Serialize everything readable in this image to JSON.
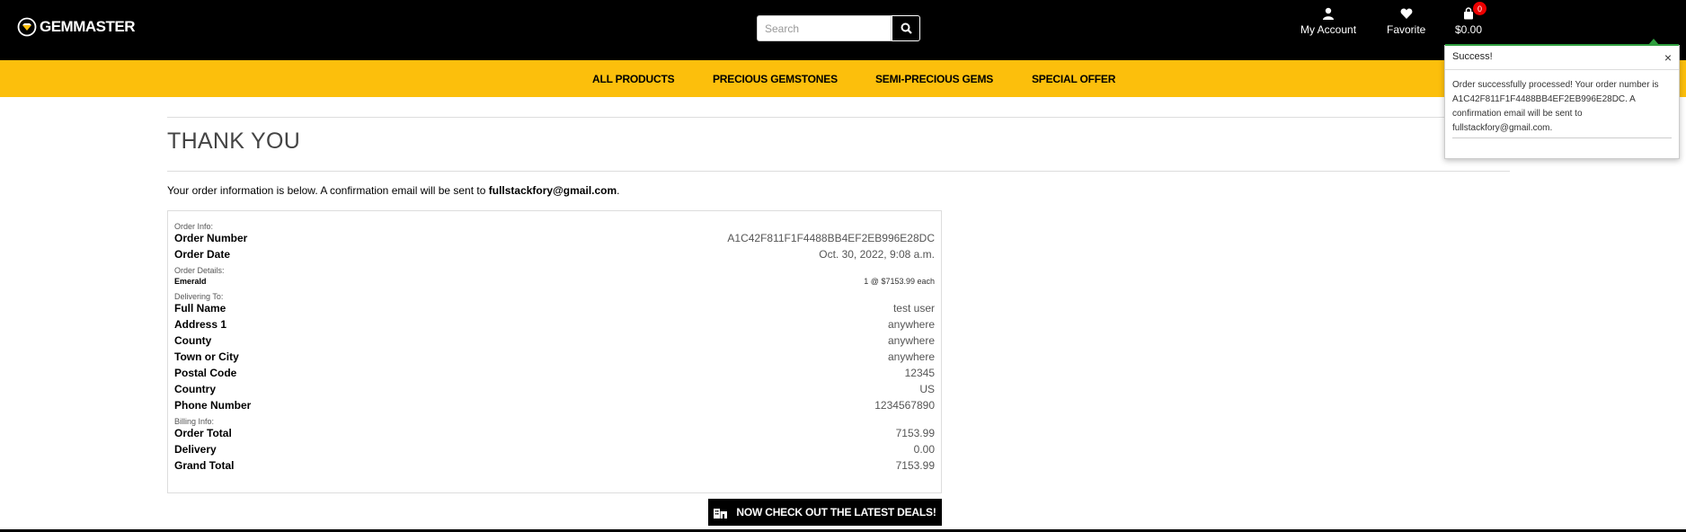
{
  "header": {
    "logo_text": "GEMMASTER",
    "search_placeholder": "Search",
    "account_label": "My Account",
    "favorite_label": "Favorite",
    "cart_total": "$0.00",
    "cart_count": "0"
  },
  "menu": [
    "ALL PRODUCTS",
    "PRECIOUS GEMSTONES",
    "SEMI-PRECIOUS GEMS",
    "SPECIAL OFFER"
  ],
  "page": {
    "title": "THANK YOU",
    "intro_prefix": "Your order information is below. A confirmation email will be sent to ",
    "email": "fullstackfory@gmail.com",
    "intro_suffix": "."
  },
  "order": {
    "order_info_label": "Order Info:",
    "order_number_label": "Order Number",
    "order_number": "A1C42F811F1F4488BB4EF2EB996E28DC",
    "order_date_label": "Order Date",
    "order_date": "Oct. 30, 2022, 9:08 a.m.",
    "order_details_label": "Order Details:",
    "item_name": "Emerald",
    "item_qty_price": "1 @ $7153.99 each",
    "delivering_label": "Delivering To:",
    "full_name_label": "Full Name",
    "full_name": "test user",
    "address1_label": "Address 1",
    "address1": "anywhere",
    "county_label": "County",
    "county": "anywhere",
    "town_label": "Town or City",
    "town": "anywhere",
    "postal_label": "Postal Code",
    "postal": "12345",
    "country_label": "Country",
    "country": "US",
    "phone_label": "Phone Number",
    "phone": "1234567890",
    "billing_label": "Billing Info:",
    "order_total_label": "Order Total",
    "order_total": "7153.99",
    "delivery_label": "Delivery",
    "delivery": "0.00",
    "grand_total_label": "Grand Total",
    "grand_total": "7153.99"
  },
  "deals_button": "NOW CHECK OUT THE LATEST DEALS!",
  "toast": {
    "title": "Success!",
    "close": "×",
    "message": "Order successfully processed! Your order number is A1C42F811F1F4488BB4EF2EB996E28DC. A confirmation email will be sent to fullstackfory@gmail.com."
  },
  "colors": {
    "header_bg": "#000000",
    "nav_bg": "#fcbf0c",
    "success": "#2e9e3e",
    "badge": "#ee0000"
  },
  "icons": [
    "gem-logo-icon",
    "search-icon",
    "user-icon",
    "heart-icon",
    "shopping-bag-icon",
    "close-icon",
    "store-icon"
  ]
}
